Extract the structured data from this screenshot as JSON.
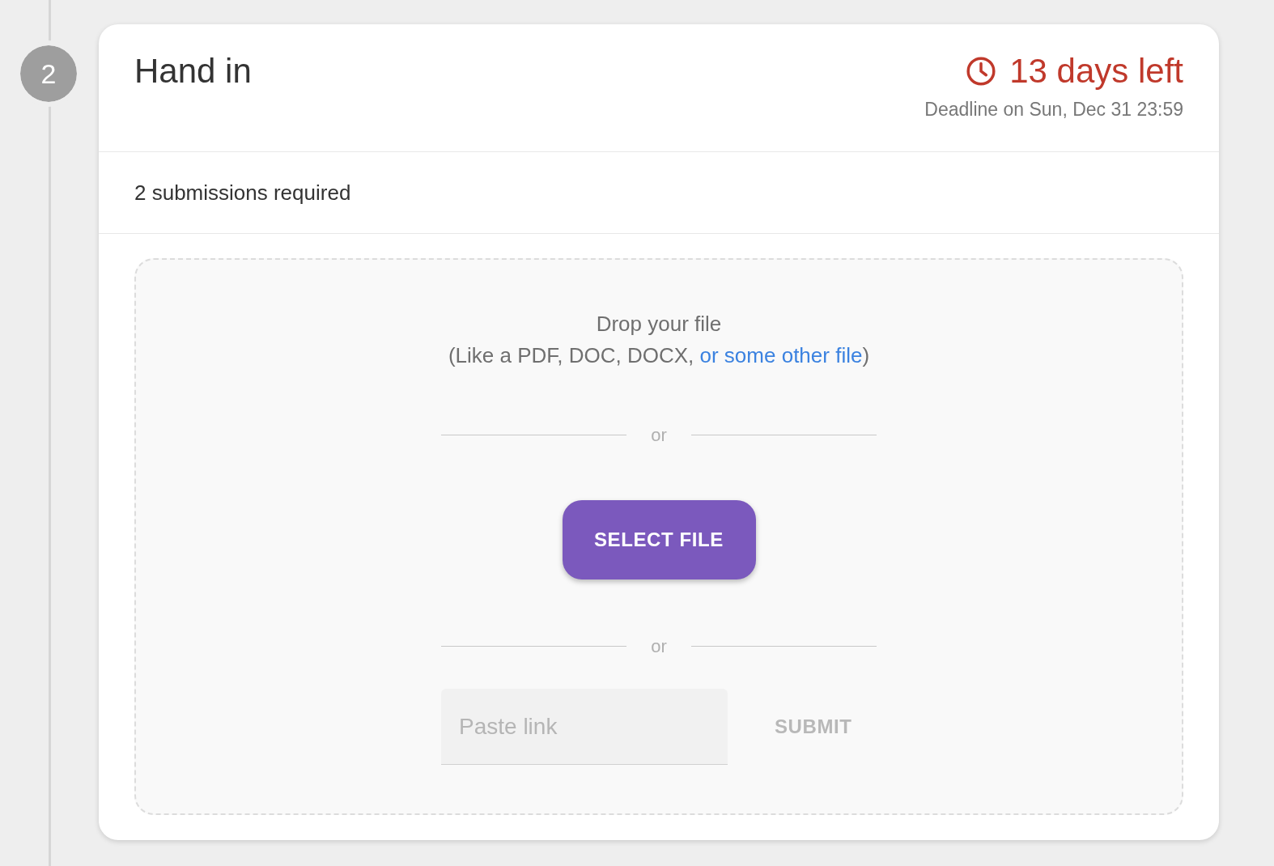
{
  "step": {
    "number": "2"
  },
  "card": {
    "title": "Hand in",
    "countdown": "13 days left",
    "deadline": "Deadline on Sun, Dec 31 23:59",
    "requirement": "2 submissions required"
  },
  "dropzone": {
    "title": "Drop your file",
    "hint_prefix": "(Like a PDF, DOC, DOCX, ",
    "hint_link": "or some other file",
    "hint_suffix": ")",
    "separators": [
      "or",
      "or"
    ],
    "select_button": "SELECT FILE",
    "link_field": {
      "placeholder": "Paste link"
    },
    "submit": {
      "label": "SUBMIT",
      "disabled": true
    }
  }
}
